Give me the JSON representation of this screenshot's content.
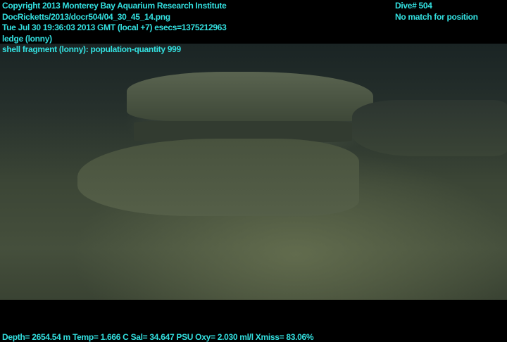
{
  "overlay_top_left": [
    "Copyright 2013 Monterey Bay Aquarium Research Institute",
    "DocRicketts/2013/docr504/04_30_45_14.png",
    "Tue Jul 30 19:36:03 2013 GMT (local +7)  esecs=1375212963",
    "ledge (lonny)",
    "shell fragment (lonny): population-quantity 999"
  ],
  "overlay_top_right": [
    "Dive# 504",
    "No match for position"
  ],
  "overlay_bottom": "Depth= 2654.54 m  Temp= 1.666 C  Sal= 34.647 PSU  Oxy= 2.030 ml/l  Xmiss= 83.06%",
  "colors": {
    "overlay_text": "#33e0e0",
    "background": "#000000"
  }
}
